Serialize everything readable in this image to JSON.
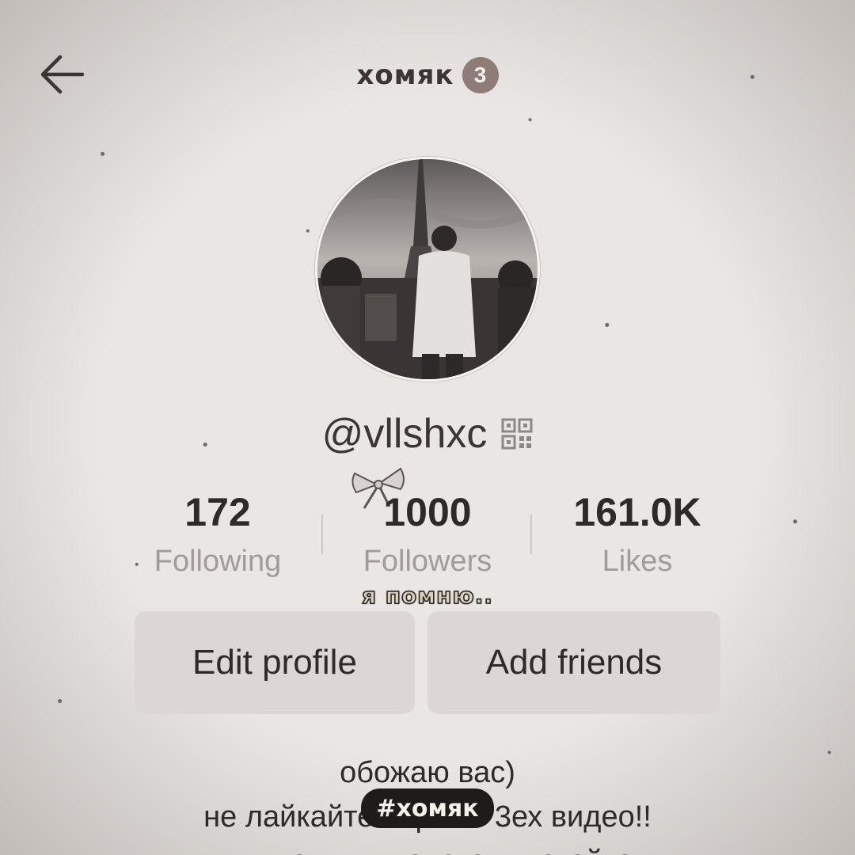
{
  "header": {
    "title": "хомяк",
    "badge_count": "3"
  },
  "profile": {
    "username": "@vllshxc"
  },
  "stats": {
    "following_value": "172",
    "following_label": "Following",
    "followers_value": "1000",
    "followers_label": "Followers",
    "likes_value": "161.0K",
    "likes_label": "Likes"
  },
  "overlay": {
    "sticker_text": "я помню..",
    "hashtag_sticker": "#хомяк"
  },
  "actions": {
    "edit_profile": "Edit profile",
    "add_friends": "Add friends"
  },
  "bio": {
    "line1": "обожаю вас)",
    "line2": "не лайкайте первые 3ех видео!!",
    "line3": "тгк: хомяк в поисках чизкейка"
  },
  "colors": {
    "background": "#e9e6e3",
    "badge": "#8f7c79",
    "button_bg": "#dcd7d4",
    "label_gray": "#a19b99"
  }
}
